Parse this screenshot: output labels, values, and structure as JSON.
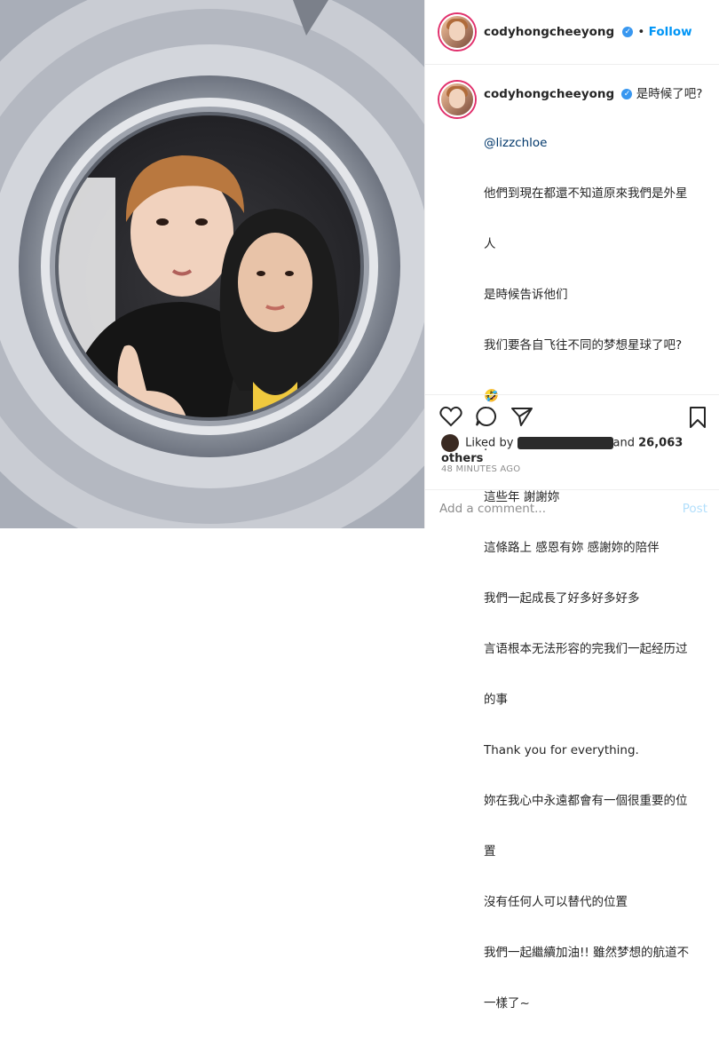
{
  "post": {
    "username": "codyhongcheeyong",
    "follow_label": "Follow",
    "verified_icon": "verified-badge-icon",
    "caption_first": "是時候了吧?",
    "mention": "@lizzchloe",
    "caption_lines": [
      "他們到現在都還不知道原來我們是外星",
      "人",
      "是時候告诉他们",
      "我们要各自飞往不同的梦想星球了吧?",
      "🤣",
      ".",
      "這些年 謝謝妳",
      "這條路上 感恩有妳 感謝妳的陪伴",
      "我們一起成長了好多好多好多",
      "言语根本无法形容的完我们一起经历过",
      "的事",
      "Thank you for everything.",
      "妳在我心中永遠都會有一個很重要的位",
      "置",
      "沒有任何人可以替代的位置",
      "我們一起繼續加油!! 雖然梦想的航道不",
      "一樣了~"
    ],
    "liked_prefix": "Liked by",
    "liked_suffix": "and",
    "others": "26,063 others",
    "time": "48 MINUTES AGO",
    "comment_placeholder": "Add a comment...",
    "post_label": "Post"
  },
  "colors": {
    "follow": "#0095f6",
    "verified": "#3897f0",
    "mention": "#00376b",
    "muted": "#8e8e8e",
    "post_disabled": "#b2dffc"
  }
}
